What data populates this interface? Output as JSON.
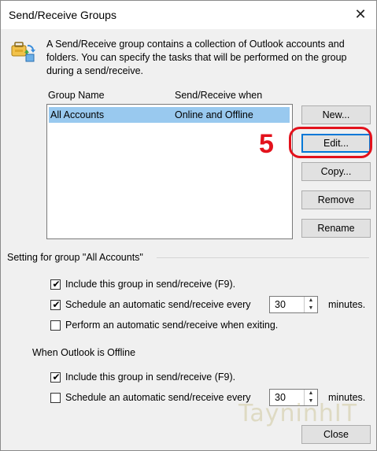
{
  "window": {
    "title": "Send/Receive Groups",
    "close_glyph": "✕"
  },
  "description": "A Send/Receive group contains a collection of Outlook accounts and folders. You can specify the tasks that will be performed on the group during a send/receive.",
  "list": {
    "columns": [
      "Group Name",
      "Send/Receive when"
    ],
    "rows": [
      {
        "name": "All Accounts",
        "when": "Online and Offline",
        "selected": true
      }
    ]
  },
  "buttons": {
    "new": "New...",
    "edit": "Edit...",
    "copy": "Copy...",
    "remove": "Remove",
    "rename": "Rename",
    "close": "Close"
  },
  "group_settings": {
    "heading": "Setting for group \"All Accounts\"",
    "online": {
      "include": {
        "label": "Include this group in send/receive (F9).",
        "checked": true
      },
      "schedule": {
        "label": "Schedule an automatic send/receive every",
        "checked": true,
        "value": "30",
        "unit": "minutes."
      },
      "on_exit": {
        "label": "Perform an automatic send/receive when exiting.",
        "checked": false
      }
    },
    "offline_heading": "When Outlook is Offline",
    "offline": {
      "include": {
        "label": "Include this group in send/receive (F9).",
        "checked": true
      },
      "schedule": {
        "label": "Schedule an automatic send/receive every",
        "checked": false,
        "value": "30",
        "unit": "minutes."
      }
    }
  },
  "annotation": {
    "step_number": "5",
    "color": "#e3121c"
  },
  "watermark": "TayninhIT",
  "icons": {
    "dialog": "send-receive-groups-icon",
    "check": "checkmark-icon"
  },
  "colors": {
    "selection": "#99c9ef",
    "focus": "#0078d7",
    "background": "#f0f0f0"
  }
}
